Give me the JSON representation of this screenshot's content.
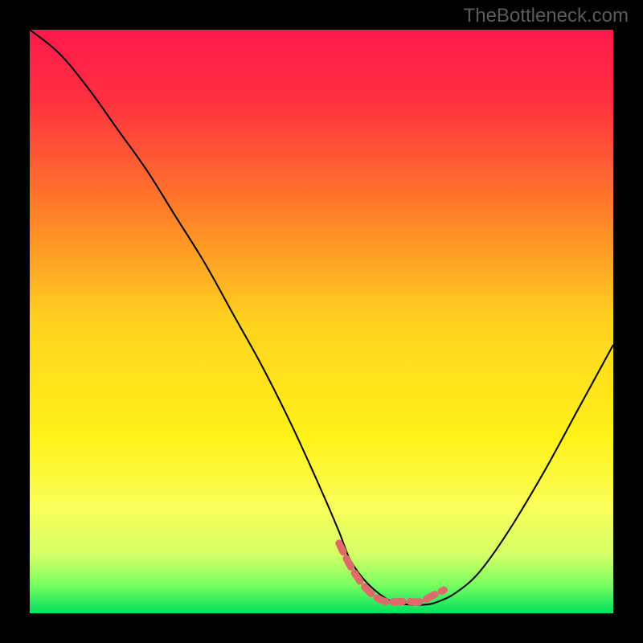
{
  "watermark": "TheBottleneck.com",
  "chart_data": {
    "type": "line",
    "title": "",
    "xlabel": "",
    "ylabel": "",
    "xlim": [
      0,
      100
    ],
    "ylim": [
      0,
      100
    ],
    "background_gradient": {
      "direction": "top-to-bottom",
      "stops": [
        {
          "pos": 0.0,
          "color": "#ff1a4d"
        },
        {
          "pos": 0.12,
          "color": "#ff3040"
        },
        {
          "pos": 0.3,
          "color": "#ff7a2a"
        },
        {
          "pos": 0.5,
          "color": "#ffd21f"
        },
        {
          "pos": 0.7,
          "color": "#fff21a"
        },
        {
          "pos": 0.82,
          "color": "#faff5a"
        },
        {
          "pos": 0.9,
          "color": "#d4ff66"
        },
        {
          "pos": 0.95,
          "color": "#7dff60"
        },
        {
          "pos": 1.0,
          "color": "#00e060"
        }
      ]
    },
    "series": [
      {
        "name": "bottleneck-curve",
        "color": "#000000",
        "width": 2,
        "x": [
          0,
          5,
          10,
          15,
          20,
          25,
          30,
          35,
          40,
          45,
          50,
          53,
          55,
          58,
          62,
          65,
          68,
          70,
          73,
          77,
          82,
          88,
          94,
          100
        ],
        "values": [
          100,
          96,
          90,
          83,
          76,
          68,
          60,
          51,
          42,
          32,
          21,
          14,
          9,
          5,
          2,
          1.5,
          1.5,
          2,
          3.5,
          7,
          14,
          24,
          35,
          46
        ]
      },
      {
        "name": "optimal-band",
        "type": "marker-band",
        "color": "#e06a6a",
        "width": 9,
        "dash": true,
        "x": [
          53,
          55,
          57,
          59,
          61,
          63,
          65,
          67,
          69,
          71
        ],
        "values": [
          12,
          8,
          5,
          3,
          2,
          2,
          2,
          2,
          3,
          4
        ]
      }
    ]
  }
}
